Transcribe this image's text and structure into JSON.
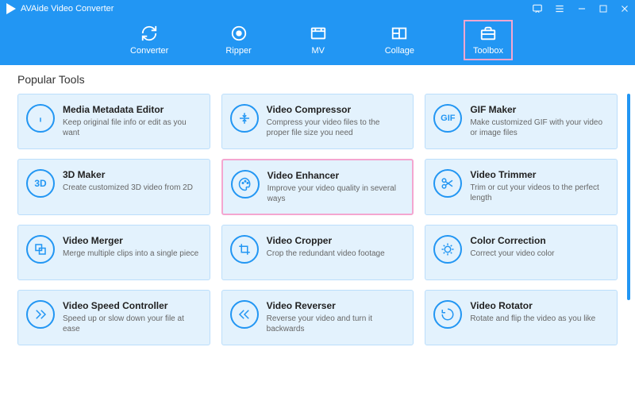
{
  "app": {
    "title": "AVAide Video Converter"
  },
  "nav": {
    "items": [
      {
        "label": "Converter"
      },
      {
        "label": "Ripper"
      },
      {
        "label": "MV"
      },
      {
        "label": "Collage"
      },
      {
        "label": "Toolbox"
      }
    ],
    "selected": 4
  },
  "section_title": "Popular Tools",
  "tools": [
    {
      "title": "Media Metadata Editor",
      "desc": "Keep original file info or edit as you want",
      "icon": "info"
    },
    {
      "title": "Video Compressor",
      "desc": "Compress your video files to the proper file size you need",
      "icon": "compress"
    },
    {
      "title": "GIF Maker",
      "desc": "Make customized GIF with your video or image files",
      "icon": "gif"
    },
    {
      "title": "3D Maker",
      "desc": "Create customized 3D video from 2D",
      "icon": "3d"
    },
    {
      "title": "Video Enhancer",
      "desc": "Improve your video quality in several ways",
      "icon": "palette",
      "highlighted": true
    },
    {
      "title": "Video Trimmer",
      "desc": "Trim or cut your videos to the perfect length",
      "icon": "scissors"
    },
    {
      "title": "Video Merger",
      "desc": "Merge multiple clips into a single piece",
      "icon": "merge"
    },
    {
      "title": "Video Cropper",
      "desc": "Crop the redundant video footage",
      "icon": "crop"
    },
    {
      "title": "Color Correction",
      "desc": "Correct your video color",
      "icon": "color"
    },
    {
      "title": "Video Speed Controller",
      "desc": "Speed up or slow down your file at ease",
      "icon": "speed"
    },
    {
      "title": "Video Reverser",
      "desc": "Reverse your video and turn it backwards",
      "icon": "reverse"
    },
    {
      "title": "Video Rotator",
      "desc": "Rotate and flip the video as you like",
      "icon": "rotate"
    }
  ]
}
